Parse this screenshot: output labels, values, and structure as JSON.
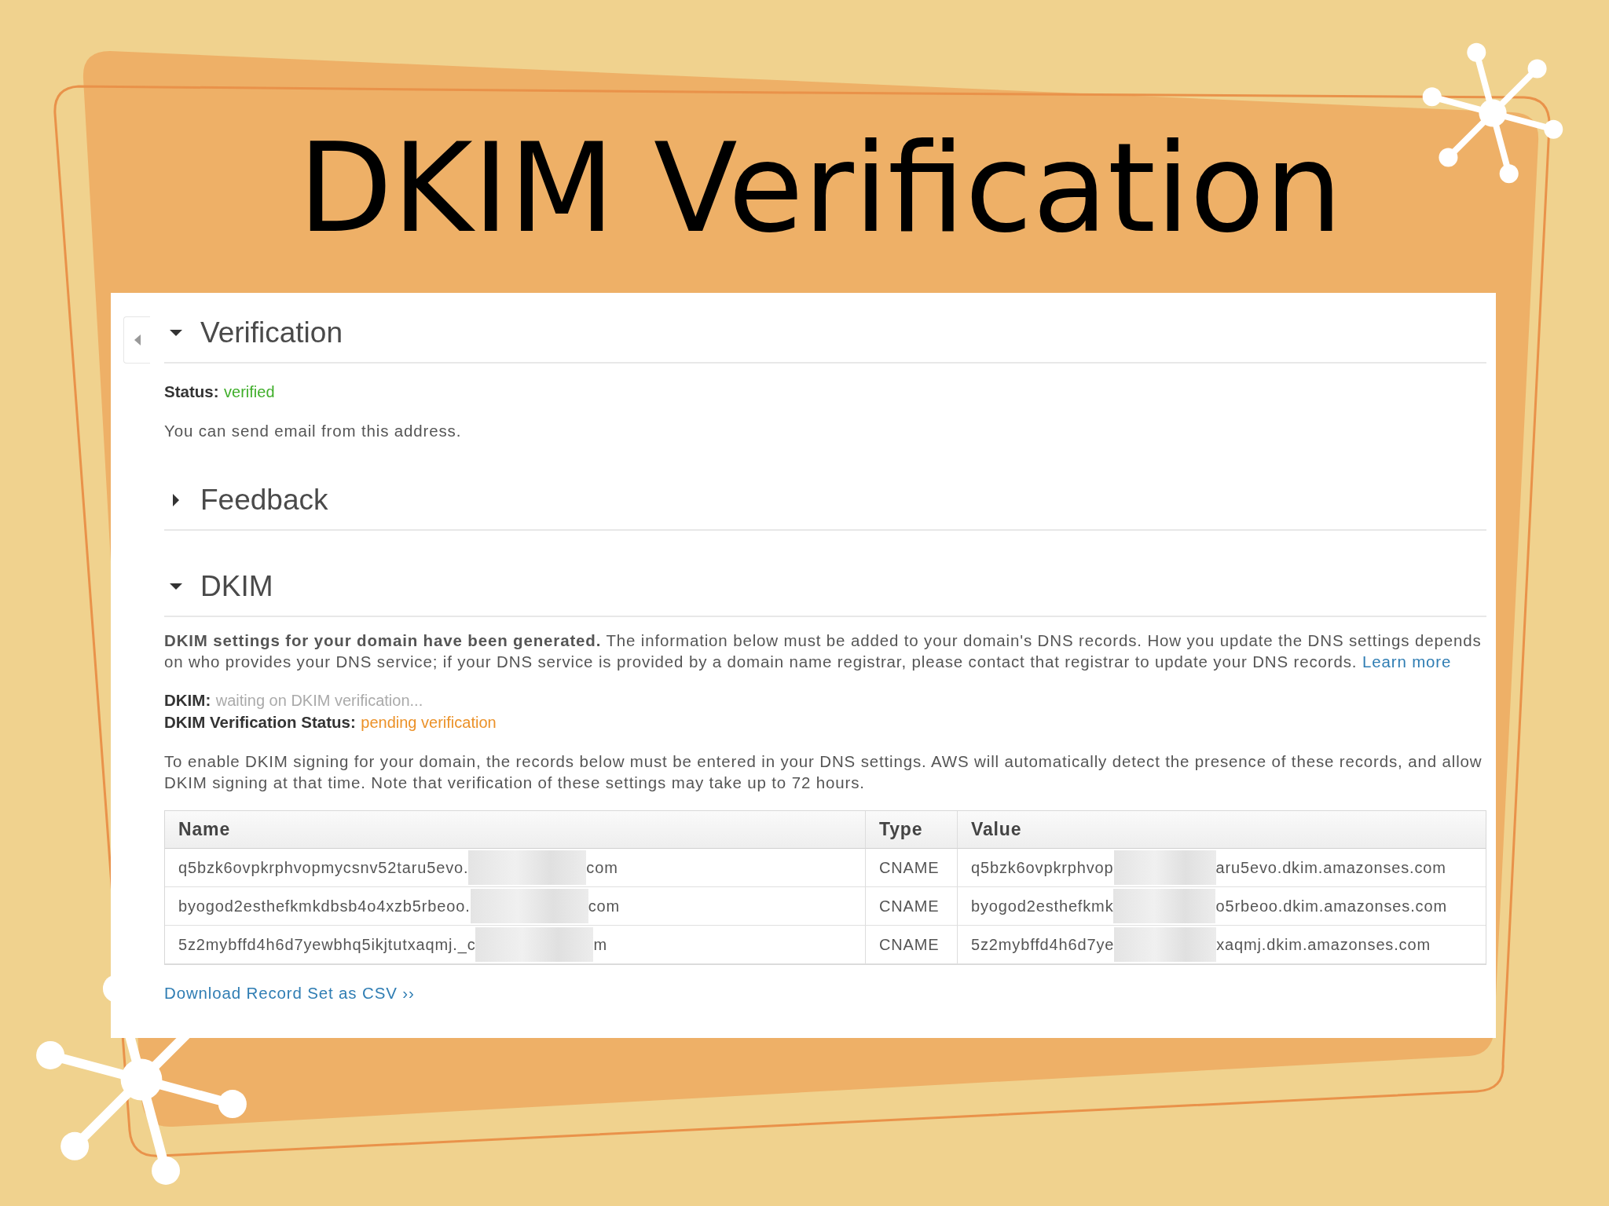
{
  "slide_title": "DKIM Verification",
  "verification": {
    "title": "Verification",
    "expanded": true,
    "status_label": "Status:",
    "status_value": "verified",
    "note": "You can send email from this address."
  },
  "feedback": {
    "title": "Feedback",
    "expanded": false
  },
  "dkim": {
    "title": "DKIM",
    "expanded": true,
    "intro": "**DKIM settings for your domain have been generated.** The information below must be added to your domain's DNS records. How you update the DNS settings depends on who provides your DNS service; if your DNS service is provided by a domain name registrar, please contact that registrar to update your DNS records.",
    "learn_more": "Learn more",
    "dkim_label": "DKIM:",
    "dkim_value": "waiting on DKIM verification...",
    "status_label": "DKIM Verification Status:",
    "status_value": "pending verification",
    "instructions": "To enable DKIM signing for your domain, the records below must be entered in your DNS settings. AWS will automatically detect the presence of these records, and allow DKIM signing at that time. Note that verification of these settings may take up to 72 hours.",
    "table": {
      "columns": [
        "Name",
        "Type",
        "Value"
      ],
      "rows": [
        {
          "name_start": "q5bzk6ovpkrphvopmycsnv52taru5evo.",
          "name_end": "com",
          "type": "CNAME",
          "value_start": "q5bzk6ovpkrphvop",
          "value_end": "aru5evo.dkim.amazonses.com"
        },
        {
          "name_start": "byogod2esthefkmkdbsb4o4xzb5rbeoo.",
          "name_end": "com",
          "type": "CNAME",
          "value_start": "byogod2esthefkmk",
          "value_end": "o5rbeoo.dkim.amazonses.com"
        },
        {
          "name_start": "5z2mybffd4h6d7yewbhq5ikjtutxaqmj._c",
          "name_end": "m",
          "type": "CNAME",
          "value_start": "5z2mybffd4h6d7ye",
          "value_end": "xaqmj.dkim.amazonses.com"
        }
      ]
    },
    "download_link": "Download Record Set as CSV ››"
  }
}
